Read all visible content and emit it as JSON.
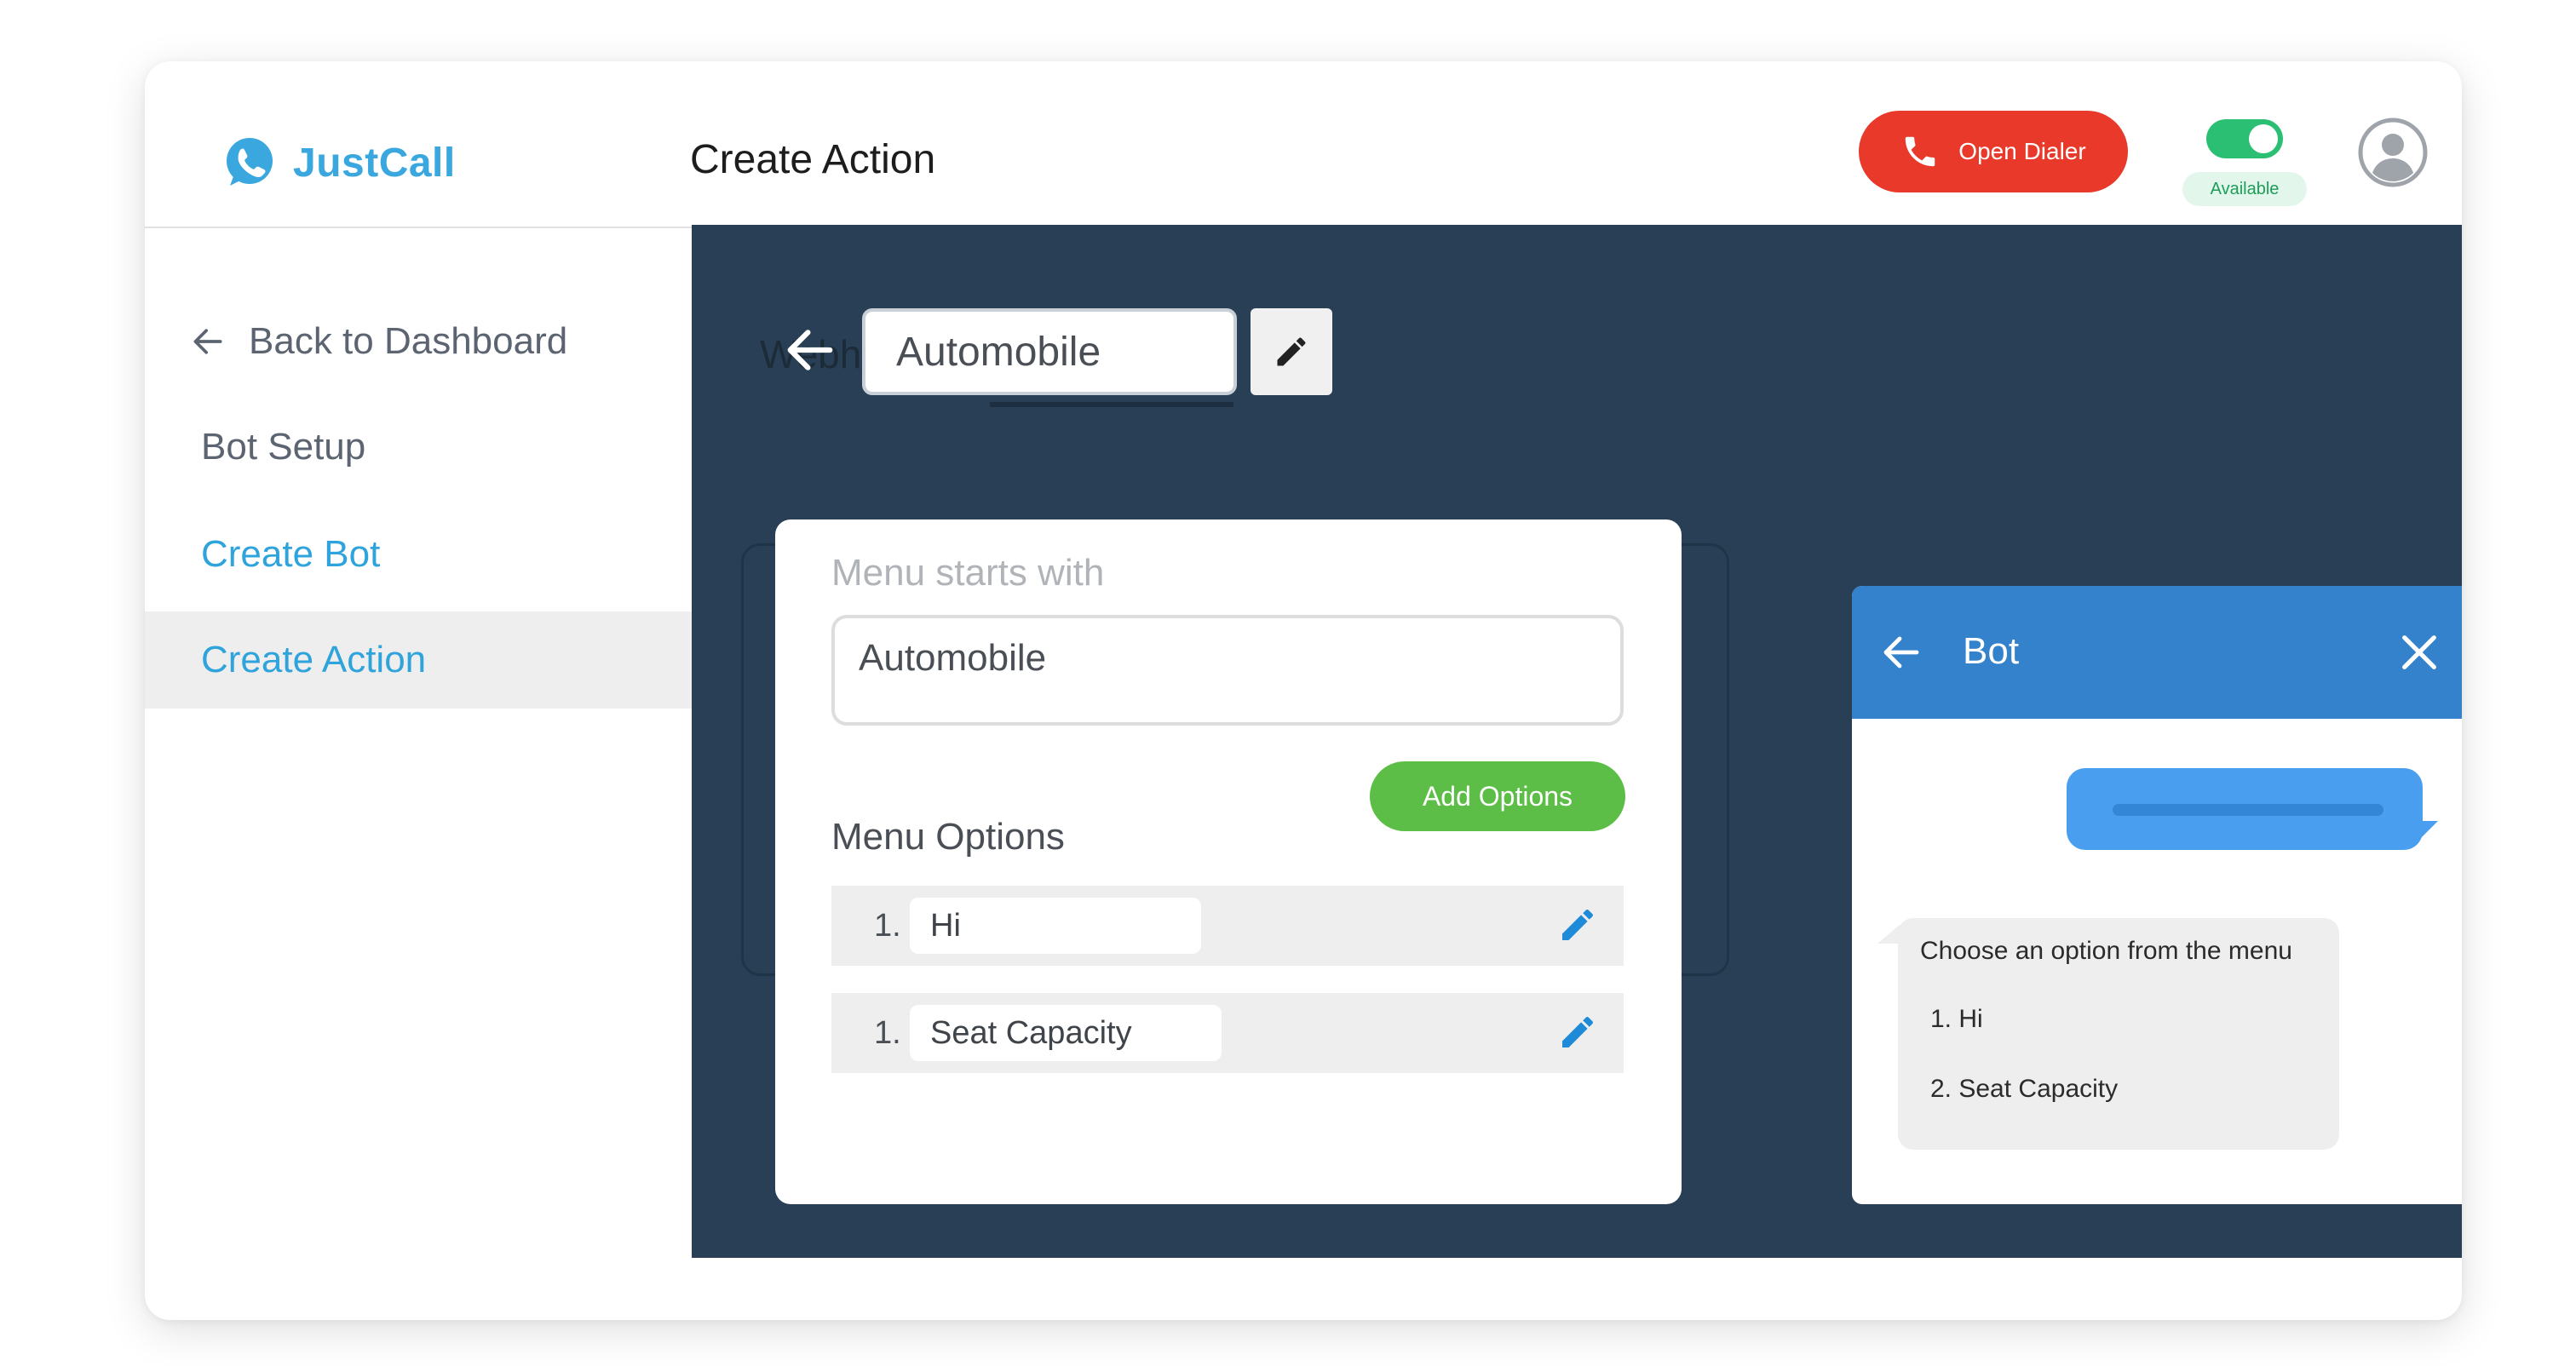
{
  "app": {
    "name": "JustCall"
  },
  "header": {
    "title": "Create Action",
    "dialer_label": "Open Dialer",
    "status": "Available",
    "status_on": true
  },
  "sidebar": {
    "back_label": "Back to Dashboard",
    "items": [
      {
        "label": "Bot Setup",
        "active": false
      },
      {
        "label": "Create Bot",
        "active": false
      },
      {
        "label": "Create Action",
        "active": true
      }
    ]
  },
  "editor": {
    "ghost_text": "Webh",
    "name_value": "Automobile"
  },
  "menu_card": {
    "starts_with_label": "Menu starts with",
    "starts_with_value": "Automobile",
    "add_options_label": "Add Options",
    "options_title": "Menu Options",
    "options": [
      {
        "number": "1.",
        "text": "Hi"
      },
      {
        "number": "1.",
        "text": "Seat Capacity"
      }
    ]
  },
  "bot_preview": {
    "title": "Bot",
    "message": "Choose an option from the menu",
    "options": [
      "1. Hi",
      "2. Seat Capacity"
    ]
  },
  "colors": {
    "brand": "#3aa7df",
    "dialer": "#e8392a",
    "toggle": "#2bbf73",
    "main_bg": "#283f55",
    "bot_header": "#3481cc",
    "add_button": "#5cbe46",
    "edit_icon": "#1f8ad8"
  },
  "icons": [
    "whatsapp-phone-icon",
    "phone-icon",
    "user-avatar-icon",
    "arrow-left-icon",
    "pencil-icon",
    "close-icon"
  ]
}
